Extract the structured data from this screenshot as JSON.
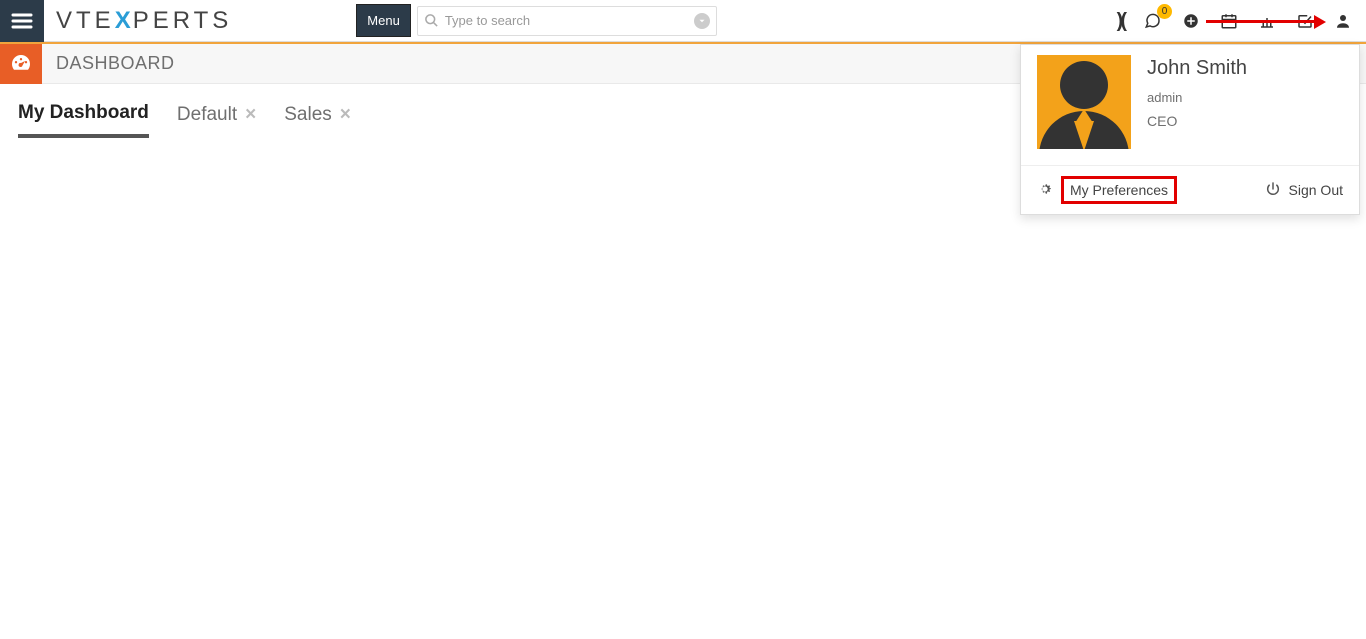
{
  "header": {
    "logo_part1": "VTE",
    "logo_part2": "X",
    "logo_part3": "PERTS",
    "menu_label": "Menu",
    "search_placeholder": "Type to search",
    "notifications_count": "0"
  },
  "title_bar": {
    "title": "DASHBOARD"
  },
  "tabs": [
    {
      "label": "My Dashboard",
      "closable": false,
      "active": true
    },
    {
      "label": "Default",
      "closable": true,
      "active": false
    },
    {
      "label": "Sales",
      "closable": true,
      "active": false
    }
  ],
  "user_menu": {
    "name": "John Smith",
    "role": "admin",
    "title": "CEO",
    "my_preferences": "My Preferences",
    "sign_out": "Sign Out"
  }
}
